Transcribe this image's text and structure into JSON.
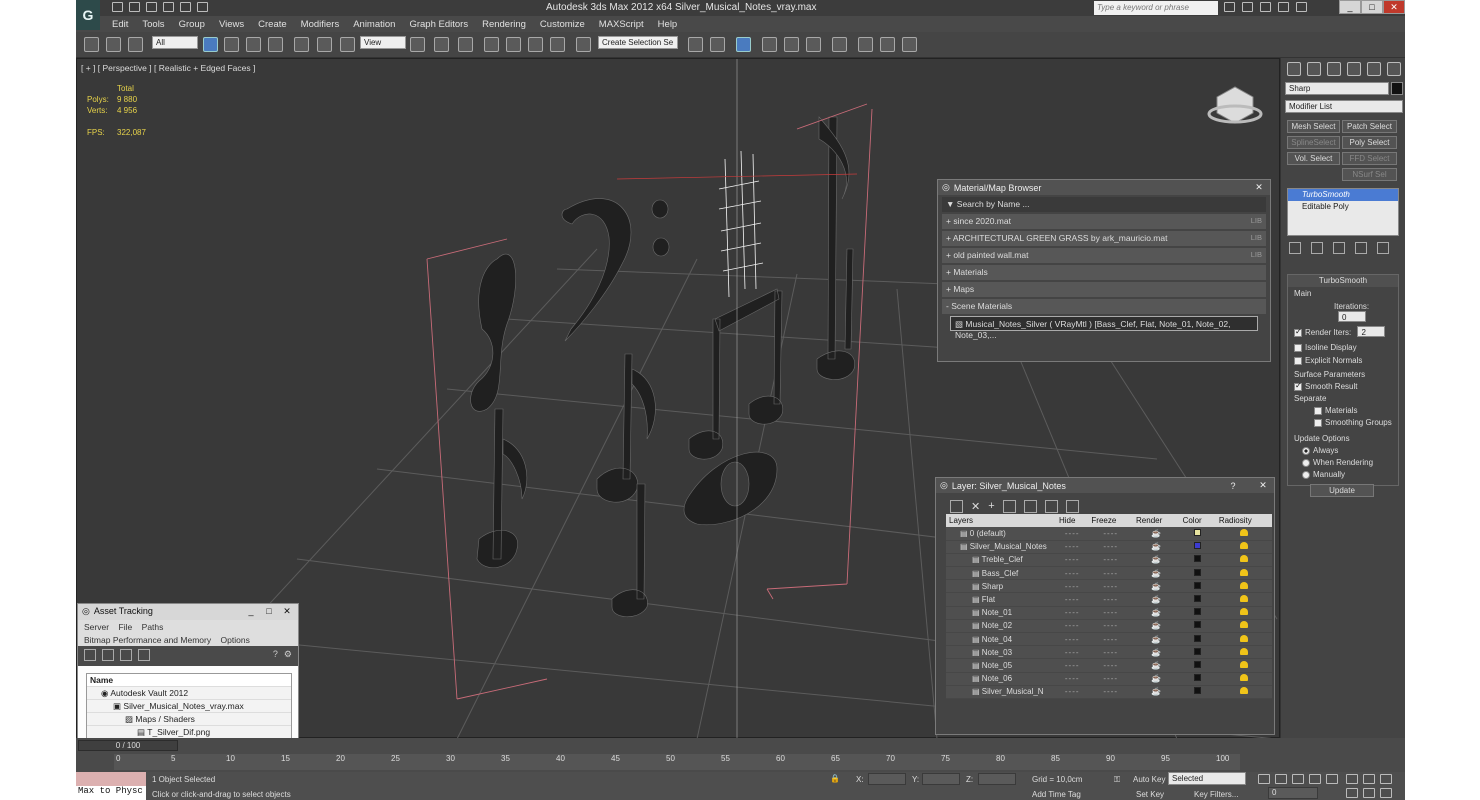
{
  "app": {
    "title": "Autodesk 3ds Max  2012 x64     Silver_Musical_Notes_vray.max",
    "search_placeholder": "Type a keyword or phrase",
    "menu": [
      "Edit",
      "Tools",
      "Group",
      "Views",
      "Create",
      "Modifiers",
      "Animation",
      "Graph Editors",
      "Rendering",
      "Customize",
      "MAXScript",
      "Help"
    ]
  },
  "toolbar": {
    "filter": "All",
    "ref_coord": "View",
    "selection_set": "Create Selection Se"
  },
  "viewport": {
    "label": "[ + ] [ Perspective ] [ Realistic + Edged Faces ]",
    "stats": {
      "total_label": "Total",
      "polys_label": "Polys:",
      "polys": "9 880",
      "verts_label": "Verts:",
      "verts": "4 956",
      "fps_label": "FPS:",
      "fps": "322,087"
    }
  },
  "command_panel": {
    "object_name": "Sharp",
    "modifier_list": "Modifier List",
    "buttons": [
      "Mesh Select",
      "Patch Select",
      "SplineSelect",
      "Poly Select",
      "Vol. Select",
      "FFD Select",
      "NSurf Sel"
    ],
    "stack": [
      "TurboSmooth",
      "Editable Poly"
    ],
    "turbosmooth": {
      "title": "TurboSmooth",
      "main": "Main",
      "iterations_label": "Iterations:",
      "iterations": "0",
      "render_iters_label": "Render Iters:",
      "render_iters": "2",
      "isoline": "Isoline Display",
      "explicit": "Explicit Normals",
      "surface": "Surface Parameters",
      "smooth_result": "Smooth Result",
      "separate": "Separate",
      "materials": "Materials",
      "smoothing_groups": "Smoothing Groups",
      "update_options": "Update Options",
      "always": "Always",
      "when_rendering": "When Rendering",
      "manually": "Manually",
      "update": "Update"
    }
  },
  "material_browser": {
    "title": "Material/Map Browser",
    "search": "Search by Name ...",
    "rows": [
      {
        "label": "+ since 2020.mat",
        "lib": "LIB"
      },
      {
        "label": "+ ARCHITECTURAL GREEN GRASS by ark_mauricio.mat",
        "lib": "LIB"
      },
      {
        "label": "+ old painted wall.mat",
        "lib": "LIB"
      },
      {
        "label": "+ Materials",
        "lib": ""
      },
      {
        "label": "+ Maps",
        "lib": ""
      },
      {
        "label": "- Scene Materials",
        "lib": ""
      }
    ],
    "scene_material": "Musical_Notes_Silver ( VRayMtl ) [Bass_Clef, Flat, Note_01, Note_02, Note_03,..."
  },
  "layer_win": {
    "title": "Layer: Silver_Musical_Notes",
    "help": "?",
    "columns": [
      "Layers",
      "Hide",
      "Freeze",
      "Render",
      "Color",
      "Radiosity"
    ],
    "rows": [
      {
        "name": "0 (default)",
        "color": "#e8e4a0",
        "indent": 0
      },
      {
        "name": "Silver_Musical_Notes",
        "color": "#3b3bd0",
        "indent": 0
      },
      {
        "name": "Treble_Clef",
        "color": "#111111",
        "indent": 1
      },
      {
        "name": "Bass_Clef",
        "color": "#111111",
        "indent": 1
      },
      {
        "name": "Sharp",
        "color": "#111111",
        "indent": 1
      },
      {
        "name": "Flat",
        "color": "#111111",
        "indent": 1
      },
      {
        "name": "Note_01",
        "color": "#111111",
        "indent": 1
      },
      {
        "name": "Note_02",
        "color": "#111111",
        "indent": 1
      },
      {
        "name": "Note_04",
        "color": "#111111",
        "indent": 1
      },
      {
        "name": "Note_03",
        "color": "#111111",
        "indent": 1
      },
      {
        "name": "Note_05",
        "color": "#111111",
        "indent": 1
      },
      {
        "name": "Note_06",
        "color": "#111111",
        "indent": 1
      },
      {
        "name": "Silver_Musical_N",
        "color": "#111111",
        "indent": 1
      }
    ]
  },
  "asset_tracking": {
    "title": "Asset Tracking",
    "menu1": [
      "Server",
      "File",
      "Paths"
    ],
    "menu2": [
      "Bitmap Performance and Memory",
      "Options"
    ],
    "col": "Name",
    "rows": [
      "Autodesk Vault 2012",
      "Silver_Musical_Notes_vray.max",
      "Maps / Shaders",
      "T_Silver_Dif.png"
    ]
  },
  "timeline": {
    "slider": "0 / 100",
    "ticks": [
      "0",
      "5",
      "10",
      "15",
      "20",
      "25",
      "30",
      "35",
      "40",
      "45",
      "50",
      "55",
      "60",
      "65",
      "70",
      "75",
      "80",
      "85",
      "90",
      "95",
      "100"
    ]
  },
  "status": {
    "maxscript": "Max to Physc",
    "selected": "1 Object Selected",
    "prompt": "Click or click-and-drag to select objects",
    "x": "X:",
    "y": "Y:",
    "z": "Z:",
    "grid": "Grid = 10,0cm",
    "add_time_tag": "Add Time Tag",
    "auto_key": "Auto Key",
    "set_key": "Set Key",
    "selected_dd": "Selected",
    "key_filters": "Key Filters...",
    "frame": "0"
  }
}
